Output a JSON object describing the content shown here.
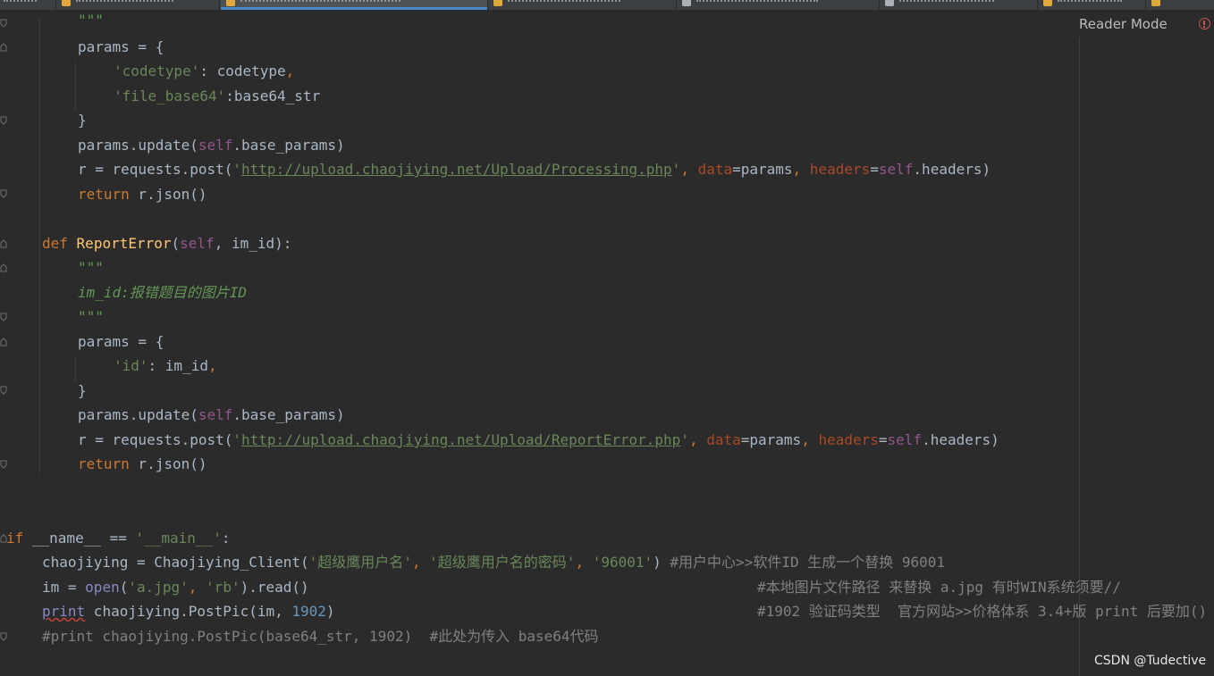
{
  "editor": {
    "reader_mode": "Reader Mode",
    "watermark": "CSDN @Tudective"
  },
  "code": {
    "l1": "\"\"\"",
    "l2_a": "params = {",
    "l3_key": "'codetype'",
    "l3_rest": ": codetype",
    "l3_comma": ",",
    "l4_key": "'file_base64'",
    "l4_rest": ":base64_str",
    "l5": "}",
    "l6_a": "params.update(",
    "l6_self": "self",
    "l6_b": ".base_params)",
    "l7_a": "r = requests.post(",
    "l7_url": "http://upload.chaojiying.net/Upload/Processing.php",
    "l7_q": "'",
    "l7_comma1": ", ",
    "l7_kw1": "data",
    "l7_b": "=params",
    "l7_comma2": ", ",
    "l7_kw2": "headers",
    "l7_eq": "=",
    "l7_self": "self",
    "l7_c": ".headers)",
    "l8_kw": "return",
    "l8_rest": " r.json()",
    "l10_def": "def",
    "l10_fn": "ReportError",
    "l10_a": "(",
    "l10_self": "self",
    "l10_b": ", im_id):",
    "l11": "\"\"\"",
    "l12": "im_id:报错题目的图片ID",
    "l13": "\"\"\"",
    "l14": "params = {",
    "l15_key": "'id'",
    "l15_rest": ": im_id",
    "l15_comma": ",",
    "l16": "}",
    "l17_a": "params.update(",
    "l17_self": "self",
    "l17_b": ".base_params)",
    "l18_a": "r = requests.post(",
    "l18_url": "http://upload.chaojiying.net/Upload/ReportError.php",
    "l18_q": "'",
    "l18_comma1": ", ",
    "l18_kw1": "data",
    "l18_b": "=params",
    "l18_comma2": ", ",
    "l18_kw2": "headers",
    "l18_eq": "=",
    "l18_self": "self",
    "l18_c": ".headers)",
    "l19_kw": "return",
    "l19_rest": " r.json()",
    "l22_if": "if",
    "l22_a": " __name__ == ",
    "l22_s": "'__main__'",
    "l22_b": ":",
    "l23_a": "chaojiying = Chaojiying_Client(",
    "l23_s1": "'超级鹰用户名'",
    "l23_c1": ", ",
    "l23_s2": "'超级鹰用户名的密码'",
    "l23_c2": ", ",
    "l23_s3": "'96001'",
    "l23_b": ") ",
    "l23_cm": "#用户中心>>软件ID 生成一个替换 96001",
    "l24_a": "im = ",
    "l24_open": "open",
    "l24_b": "(",
    "l24_s1": "'a.jpg'",
    "l24_c": ", ",
    "l24_s2": "'rb'",
    "l24_d": ").read()",
    "l24_cm": "#本地图片文件路径 来替换 a.jpg 有时WIN系统须要//",
    "l25_print": "print",
    "l25_a": " chaojiying.PostPic(im, ",
    "l25_n": "1902",
    "l25_b": ")",
    "l25_cm": "#1902 验证码类型  官方网站>>价格体系 3.4+版 print 后要加()",
    "l26": "#print chaojiying.PostPic(base64_str, 1902)  #此处为传入 base64代码"
  }
}
